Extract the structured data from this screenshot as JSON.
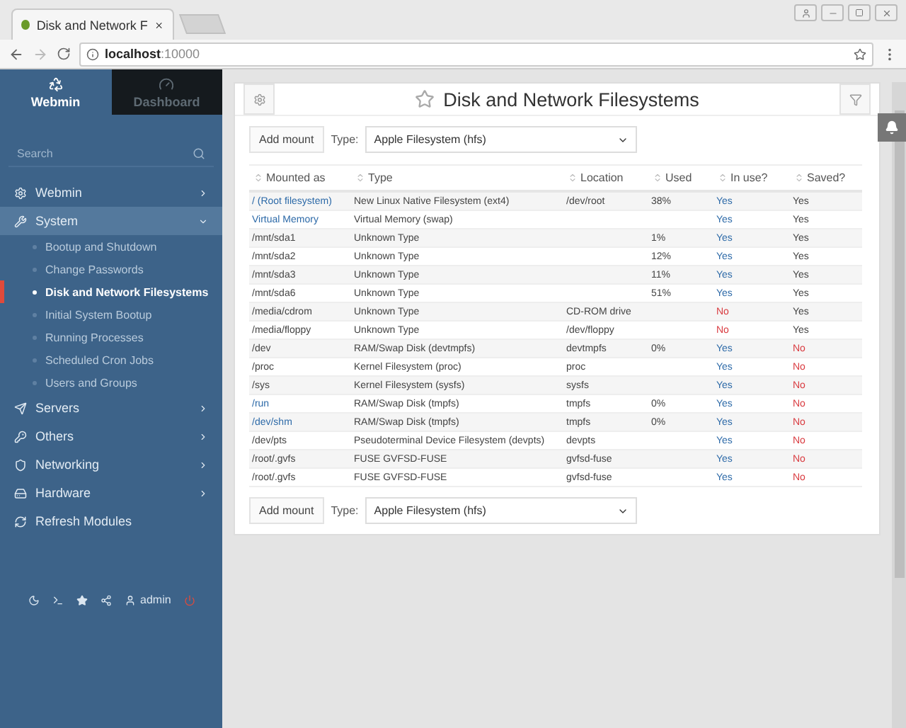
{
  "browser": {
    "tab_title": "Disk and Network F",
    "address_host": "localhost",
    "address_port": ":10000"
  },
  "sidebar": {
    "tabs": [
      {
        "label": "Webmin",
        "selected": true
      },
      {
        "label": "Dashboard",
        "selected": false
      }
    ],
    "search": {
      "placeholder": "Search"
    },
    "menu": [
      {
        "label": "Webmin",
        "expanded": false
      },
      {
        "label": "System",
        "expanded": true,
        "children": [
          {
            "label": "Bootup and Shutdown",
            "selected": false
          },
          {
            "label": "Change Passwords",
            "selected": false
          },
          {
            "label": "Disk and Network Filesystems",
            "selected": true
          },
          {
            "label": "Initial System Bootup",
            "selected": false
          },
          {
            "label": "Running Processes",
            "selected": false
          },
          {
            "label": "Scheduled Cron Jobs",
            "selected": false
          },
          {
            "label": "Users and Groups",
            "selected": false
          }
        ]
      },
      {
        "label": "Servers",
        "expanded": false
      },
      {
        "label": "Others",
        "expanded": false
      },
      {
        "label": "Networking",
        "expanded": false
      },
      {
        "label": "Hardware",
        "expanded": false
      },
      {
        "label": "Refresh Modules",
        "kind": "action"
      }
    ],
    "user": "admin"
  },
  "page": {
    "title": "Disk and Network Filesystems",
    "top_toolbar": {
      "add_button": "Add mount",
      "type_label": "Type:",
      "type_value": "Apple Filesystem (hfs)"
    },
    "table": {
      "columns": [
        "Mounted as",
        "Type",
        "Location",
        "Used",
        "In use?",
        "Saved?"
      ],
      "rows": [
        {
          "mounted": "/ (Root filesystem)",
          "linked": true,
          "type": "New Linux Native Filesystem (ext4)",
          "location": "/dev/root",
          "used": "38%",
          "in_use": {
            "text": "Yes",
            "ok": true
          },
          "saved": {
            "text": "Yes",
            "ok": true
          }
        },
        {
          "mounted": "Virtual Memory",
          "linked": true,
          "type": "Virtual Memory (swap)",
          "location": "",
          "used": "",
          "in_use": {
            "text": "Yes",
            "ok": true
          },
          "saved": {
            "text": "Yes",
            "ok": true
          }
        },
        {
          "mounted": "/mnt/sda1",
          "linked": false,
          "type": "Unknown Type",
          "location": "",
          "used": "1%",
          "in_use": {
            "text": "Yes",
            "ok": true
          },
          "saved": {
            "text": "Yes",
            "ok": true
          }
        },
        {
          "mounted": "/mnt/sda2",
          "linked": false,
          "type": "Unknown Type",
          "location": "",
          "used": "12%",
          "in_use": {
            "text": "Yes",
            "ok": true
          },
          "saved": {
            "text": "Yes",
            "ok": true
          }
        },
        {
          "mounted": "/mnt/sda3",
          "linked": false,
          "type": "Unknown Type",
          "location": "",
          "used": "11%",
          "in_use": {
            "text": "Yes",
            "ok": true
          },
          "saved": {
            "text": "Yes",
            "ok": true
          }
        },
        {
          "mounted": "/mnt/sda6",
          "linked": false,
          "type": "Unknown Type",
          "location": "",
          "used": "51%",
          "in_use": {
            "text": "Yes",
            "ok": true
          },
          "saved": {
            "text": "Yes",
            "ok": true
          }
        },
        {
          "mounted": "/media/cdrom",
          "linked": false,
          "type": "Unknown Type",
          "location": "CD-ROM drive",
          "used": "",
          "in_use": {
            "text": "No",
            "ok": false
          },
          "saved": {
            "text": "Yes",
            "ok": true
          }
        },
        {
          "mounted": "/media/floppy",
          "linked": false,
          "type": "Unknown Type",
          "location": "/dev/floppy",
          "used": "",
          "in_use": {
            "text": "No",
            "ok": false
          },
          "saved": {
            "text": "Yes",
            "ok": true
          }
        },
        {
          "mounted": "/dev",
          "linked": false,
          "type": "RAM/Swap Disk (devtmpfs)",
          "location": "devtmpfs",
          "used": "0%",
          "in_use": {
            "text": "Yes",
            "ok": true
          },
          "saved": {
            "text": "No",
            "ok": false
          }
        },
        {
          "mounted": "/proc",
          "linked": false,
          "type": "Kernel Filesystem (proc)",
          "location": "proc",
          "used": "",
          "in_use": {
            "text": "Yes",
            "ok": true
          },
          "saved": {
            "text": "No",
            "ok": false
          }
        },
        {
          "mounted": "/sys",
          "linked": false,
          "type": "Kernel Filesystem (sysfs)",
          "location": "sysfs",
          "used": "",
          "in_use": {
            "text": "Yes",
            "ok": true
          },
          "saved": {
            "text": "No",
            "ok": false
          }
        },
        {
          "mounted": "/run",
          "linked": true,
          "type": "RAM/Swap Disk (tmpfs)",
          "location": "tmpfs",
          "used": "0%",
          "in_use": {
            "text": "Yes",
            "ok": true
          },
          "saved": {
            "text": "No",
            "ok": false
          }
        },
        {
          "mounted": "/dev/shm",
          "linked": true,
          "type": "RAM/Swap Disk (tmpfs)",
          "location": "tmpfs",
          "used": "0%",
          "in_use": {
            "text": "Yes",
            "ok": true
          },
          "saved": {
            "text": "No",
            "ok": false
          }
        },
        {
          "mounted": "/dev/pts",
          "linked": false,
          "type": "Pseudoterminal Device Filesystem (devpts)",
          "location": "devpts",
          "used": "",
          "in_use": {
            "text": "Yes",
            "ok": true
          },
          "saved": {
            "text": "No",
            "ok": false
          }
        },
        {
          "mounted": "/root/.gvfs",
          "linked": false,
          "type": "FUSE GVFSD-FUSE",
          "location": "gvfsd-fuse",
          "used": "",
          "in_use": {
            "text": "Yes",
            "ok": true
          },
          "saved": {
            "text": "No",
            "ok": false
          }
        },
        {
          "mounted": "/root/.gvfs",
          "linked": false,
          "type": "FUSE GVFSD-FUSE",
          "location": "gvfsd-fuse",
          "used": "",
          "in_use": {
            "text": "Yes",
            "ok": true
          },
          "saved": {
            "text": "No",
            "ok": false
          }
        }
      ]
    },
    "bottom_toolbar": {
      "add_button": "Add mount",
      "type_label": "Type:",
      "type_value": "Apple Filesystem (hfs)"
    }
  }
}
